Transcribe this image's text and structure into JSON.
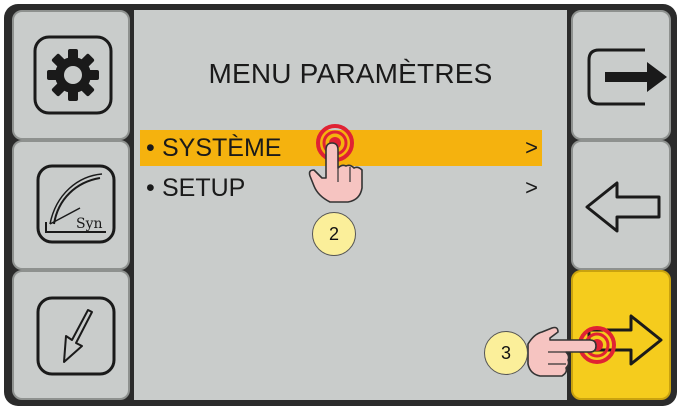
{
  "menu": {
    "title": "MENU PARAMÈTRES",
    "items": [
      {
        "bullet": "•",
        "label": "SYSTÈME",
        "arrow": ">",
        "selected": true
      },
      {
        "bullet": "•",
        "label": "SETUP",
        "arrow": ">",
        "selected": false
      }
    ]
  },
  "left_buttons": [
    {
      "icon": "gear-icon"
    },
    {
      "icon": "syn-curve-icon",
      "label": "Syn"
    },
    {
      "icon": "down-arrow-icon"
    }
  ],
  "right_buttons": [
    {
      "icon": "exit-arrow-icon"
    },
    {
      "icon": "back-arrow-icon"
    },
    {
      "icon": "forward-arrow-icon",
      "active": true
    }
  ],
  "annotations": [
    {
      "step": "2",
      "target": "SYSTÈME"
    },
    {
      "step": "3",
      "target": "forward-arrow"
    }
  ],
  "colors": {
    "panel_bg": "#c9cccb",
    "highlight": "#f5b20e",
    "active_button": "#f5cc1d",
    "frame": "#2b2b2b",
    "tap_red": "#e02233",
    "badge": "#fbef9a"
  }
}
